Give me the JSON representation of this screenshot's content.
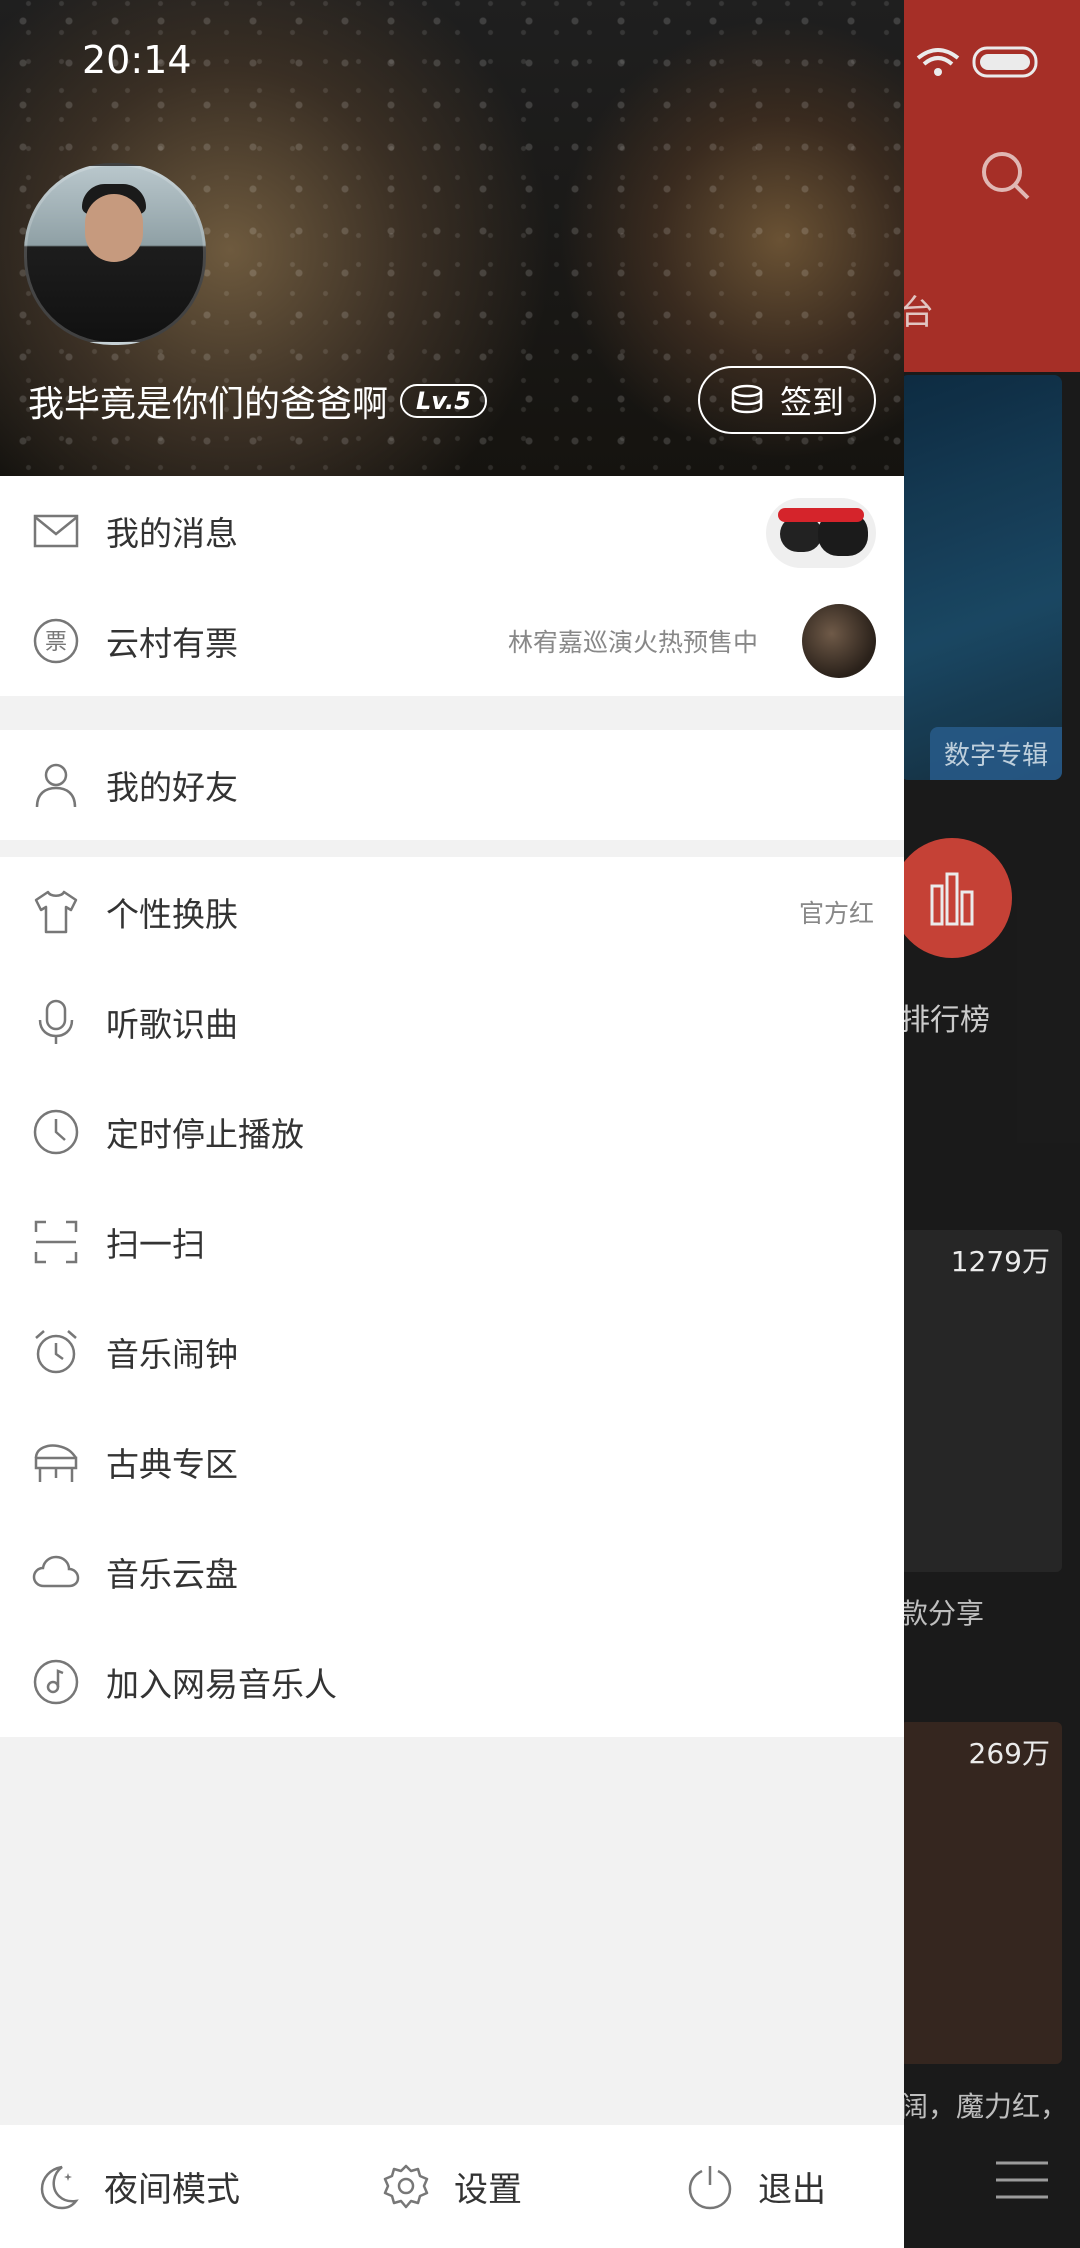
{
  "status_bar": {
    "time": "20:14"
  },
  "background": {
    "tab_fragment": "台",
    "panel_tag": "数字专辑",
    "rank_label": "排行榜",
    "card1_count": "1279万",
    "card1_caption": "款分享",
    "card2_count": "269万",
    "card2_caption": "阔，魔力红，"
  },
  "profile": {
    "username": "我毕竟是你们的爸爸啊",
    "level": "Lv.5",
    "checkin_label": "签到"
  },
  "menu": {
    "messages": {
      "label": "我的消息"
    },
    "tickets": {
      "label": "云村有票",
      "right_text": "林宥嘉巡演火热预售中"
    },
    "friends": {
      "label": "我的好友"
    },
    "skin": {
      "label": "个性换肤",
      "right_text": "官方红"
    },
    "recognize": {
      "label": "听歌识曲"
    },
    "timer": {
      "label": "定时停止播放"
    },
    "scan": {
      "label": "扫一扫"
    },
    "alarm": {
      "label": "音乐闹钟"
    },
    "classical": {
      "label": "古典专区"
    },
    "cloud": {
      "label": "音乐云盘"
    },
    "musician": {
      "label": "加入网易音乐人"
    }
  },
  "bottom_bar": {
    "night_mode": "夜间模式",
    "settings": "设置",
    "logout": "退出"
  },
  "icons": {
    "mail": "mail-icon",
    "ticket": "ticket-icon",
    "friend": "person-icon",
    "skin": "tshirt-icon",
    "recognize": "mic-icon",
    "timer": "clock-icon",
    "scan": "scan-icon",
    "alarm": "alarm-icon",
    "classical": "piano-icon",
    "cloud": "cloud-icon",
    "musician": "music-disc-icon",
    "night": "moon-icon",
    "settings": "gear-icon",
    "logout": "power-icon"
  },
  "colors": {
    "brand_red": "#b5332b",
    "text": "#333333",
    "secondary": "#888888"
  }
}
